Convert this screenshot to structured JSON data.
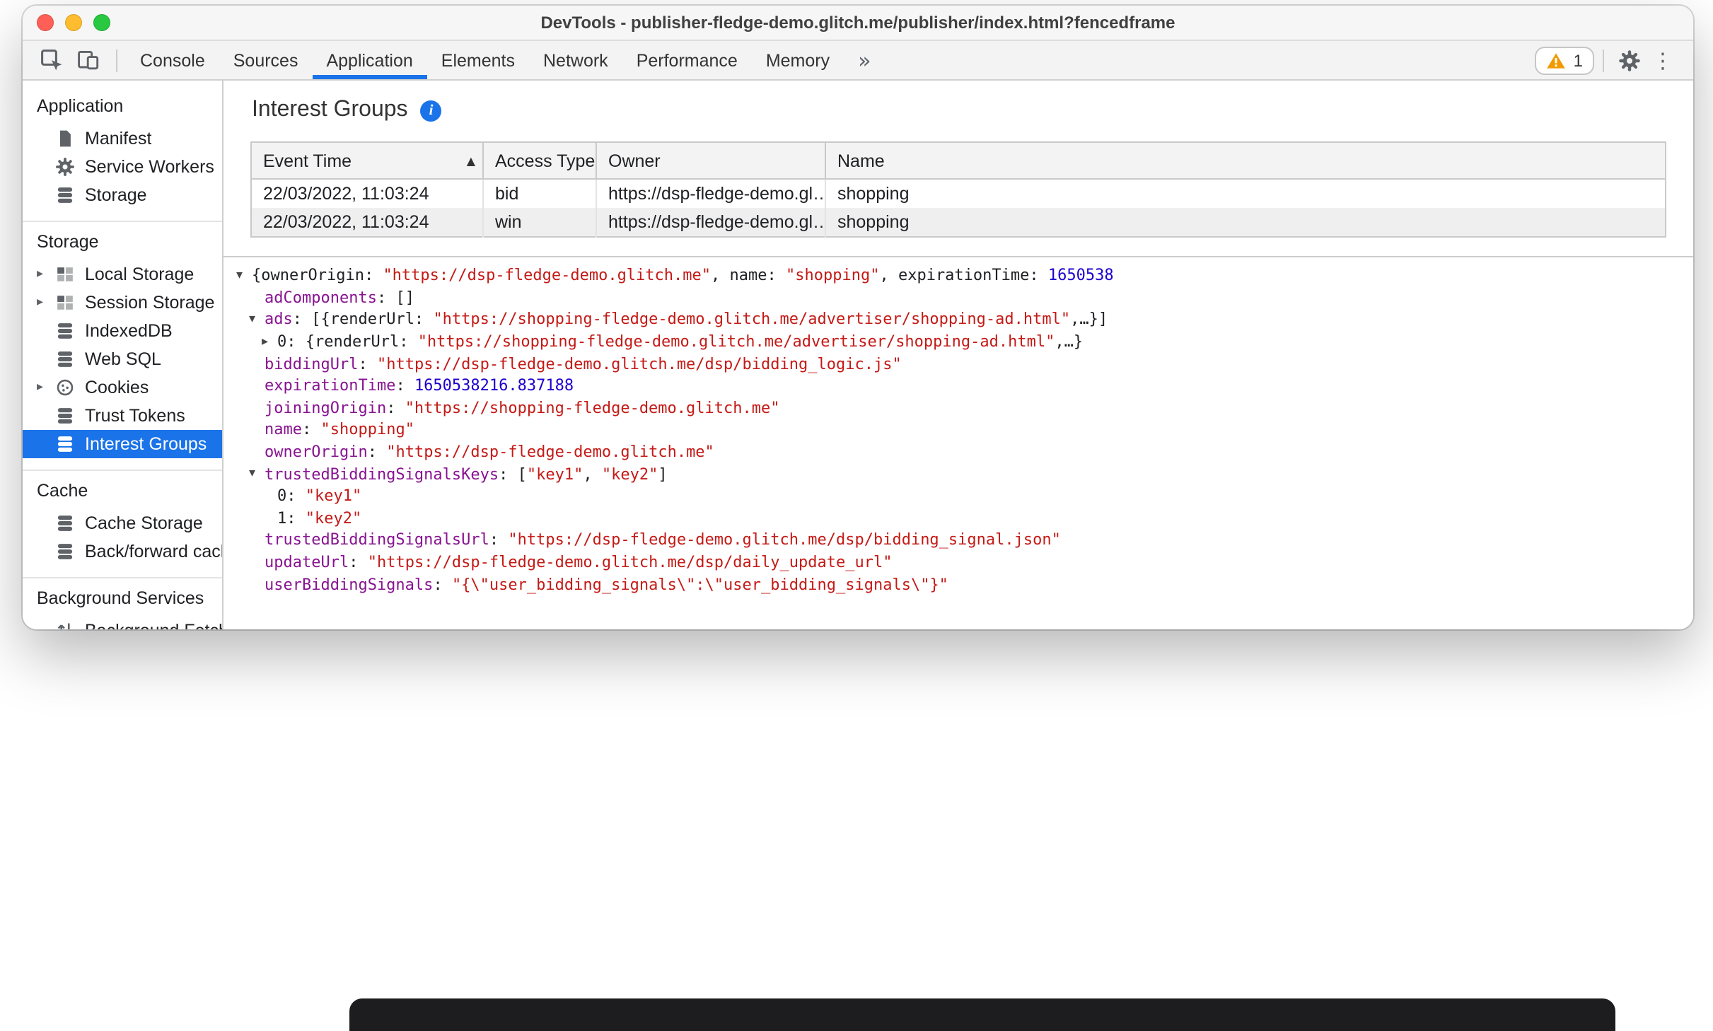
{
  "window": {
    "title": "DevTools - publisher-fledge-demo.glitch.me/publisher/index.html?fencedframe",
    "traffic_lights": {
      "close": "#ff5f57",
      "minimize": "#febc2e",
      "zoom": "#28c840"
    }
  },
  "toolbar": {
    "left_icons": [
      "inspect-icon",
      "device-toolbar-icon"
    ],
    "tabs": [
      {
        "label": "Console",
        "active": false
      },
      {
        "label": "Sources",
        "active": false
      },
      {
        "label": "Application",
        "active": true
      },
      {
        "label": "Elements",
        "active": false
      },
      {
        "label": "Network",
        "active": false
      },
      {
        "label": "Performance",
        "active": false
      },
      {
        "label": "Memory",
        "active": false
      }
    ],
    "warning_badge_count": "1",
    "right_icons": [
      "warning-badge",
      "settings-gear-icon",
      "more-options-icon"
    ]
  },
  "sidebar": {
    "sections": [
      {
        "header": "Application",
        "items": [
          {
            "label": "Manifest",
            "icon": "document-icon"
          },
          {
            "label": "Service Workers",
            "icon": "gear-icon"
          },
          {
            "label": "Storage",
            "icon": "database-icon"
          }
        ]
      },
      {
        "header": "Storage",
        "items": [
          {
            "label": "Local Storage",
            "icon": "table-icon",
            "expandable": true
          },
          {
            "label": "Session Storage",
            "icon": "table-icon",
            "expandable": true
          },
          {
            "label": "IndexedDB",
            "icon": "database-icon"
          },
          {
            "label": "Web SQL",
            "icon": "database-icon"
          },
          {
            "label": "Cookies",
            "icon": "cookie-icon",
            "expandable": true
          },
          {
            "label": "Trust Tokens",
            "icon": "database-icon"
          },
          {
            "label": "Interest Groups",
            "icon": "database-icon",
            "selected": true
          }
        ]
      },
      {
        "header": "Cache",
        "items": [
          {
            "label": "Cache Storage",
            "icon": "database-icon"
          },
          {
            "label": "Back/forward cach",
            "icon": "database-icon"
          }
        ]
      },
      {
        "header": "Background Services",
        "items": [
          {
            "label": "Background Fetch",
            "icon": "fetch-icon"
          }
        ]
      }
    ]
  },
  "main": {
    "title": "Interest Groups",
    "info_icon": "info-icon",
    "table": {
      "columns": [
        "Event Time",
        "Access Type",
        "Owner",
        "Name"
      ],
      "sorted_by": "Event Time",
      "sort_direction": "ascending",
      "rows": [
        [
          "22/03/2022, 11:03:24",
          "bid",
          "https://dsp-fledge-demo.gl…",
          "shopping"
        ],
        [
          "22/03/2022, 11:03:24",
          "win",
          "https://dsp-fledge-demo.gl…",
          "shopping"
        ]
      ]
    },
    "tree": {
      "lines": [
        {
          "level": 0,
          "arrow": "down",
          "segments": [
            {
              "text": "{ownerOrigin: ",
              "cls": "plain"
            },
            {
              "text": "\"https://dsp-fledge-demo.glitch.me\"",
              "cls": "string"
            },
            {
              "text": ", name: ",
              "cls": "plain"
            },
            {
              "text": "\"shopping\"",
              "cls": "string"
            },
            {
              "text": ", expirationTime: ",
              "cls": "plain"
            },
            {
              "text": "1650538",
              "cls": "number"
            }
          ]
        },
        {
          "level": 1,
          "arrow": "none",
          "segments": [
            {
              "text": "adComponents",
              "cls": "key"
            },
            {
              "text": ": []",
              "cls": "plain"
            }
          ]
        },
        {
          "level": 1,
          "arrow": "down",
          "segments": [
            {
              "text": "ads",
              "cls": "key"
            },
            {
              "text": ": [{renderUrl: ",
              "cls": "plain"
            },
            {
              "text": "\"https://shopping-fledge-demo.glitch.me/advertiser/shopping-ad.html\"",
              "cls": "string"
            },
            {
              "text": ",…}]",
              "cls": "plain"
            }
          ]
        },
        {
          "level": 2,
          "arrow": "right",
          "segments": [
            {
              "text": "0",
              "cls": "index"
            },
            {
              "text": ": {renderUrl: ",
              "cls": "plain"
            },
            {
              "text": "\"https://shopping-fledge-demo.glitch.me/advertiser/shopping-ad.html\"",
              "cls": "string"
            },
            {
              "text": ",…}",
              "cls": "plain"
            }
          ]
        },
        {
          "level": 1,
          "arrow": "none",
          "segments": [
            {
              "text": "biddingUrl",
              "cls": "key"
            },
            {
              "text": ": ",
              "cls": "plain"
            },
            {
              "text": "\"https://dsp-fledge-demo.glitch.me/dsp/bidding_logic.js\"",
              "cls": "string"
            }
          ]
        },
        {
          "level": 1,
          "arrow": "none",
          "segments": [
            {
              "text": "expirationTime",
              "cls": "key"
            },
            {
              "text": ": ",
              "cls": "plain"
            },
            {
              "text": "1650538216.837188",
              "cls": "number"
            }
          ]
        },
        {
          "level": 1,
          "arrow": "none",
          "segments": [
            {
              "text": "joiningOrigin",
              "cls": "key"
            },
            {
              "text": ": ",
              "cls": "plain"
            },
            {
              "text": "\"https://shopping-fledge-demo.glitch.me\"",
              "cls": "string"
            }
          ]
        },
        {
          "level": 1,
          "arrow": "none",
          "segments": [
            {
              "text": "name",
              "cls": "key"
            },
            {
              "text": ": ",
              "cls": "plain"
            },
            {
              "text": "\"shopping\"",
              "cls": "string"
            }
          ]
        },
        {
          "level": 1,
          "arrow": "none",
          "segments": [
            {
              "text": "ownerOrigin",
              "cls": "key"
            },
            {
              "text": ": ",
              "cls": "plain"
            },
            {
              "text": "\"https://dsp-fledge-demo.glitch.me\"",
              "cls": "string"
            }
          ]
        },
        {
          "level": 1,
          "arrow": "down",
          "segments": [
            {
              "text": "trustedBiddingSignalsKeys",
              "cls": "key"
            },
            {
              "text": ": [",
              "cls": "plain"
            },
            {
              "text": "\"key1\"",
              "cls": "string"
            },
            {
              "text": ", ",
              "cls": "plain"
            },
            {
              "text": "\"key2\"",
              "cls": "string"
            },
            {
              "text": "]",
              "cls": "plain"
            }
          ]
        },
        {
          "level": 2,
          "arrow": "none",
          "segments": [
            {
              "text": "0",
              "cls": "index"
            },
            {
              "text": ": ",
              "cls": "plain"
            },
            {
              "text": "\"key1\"",
              "cls": "string"
            }
          ]
        },
        {
          "level": 2,
          "arrow": "none",
          "segments": [
            {
              "text": "1",
              "cls": "index"
            },
            {
              "text": ": ",
              "cls": "plain"
            },
            {
              "text": "\"key2\"",
              "cls": "string"
            }
          ]
        },
        {
          "level": 1,
          "arrow": "none",
          "segments": [
            {
              "text": "trustedBiddingSignalsUrl",
              "cls": "key"
            },
            {
              "text": ": ",
              "cls": "plain"
            },
            {
              "text": "\"https://dsp-fledge-demo.glitch.me/dsp/bidding_signal.json\"",
              "cls": "string"
            }
          ]
        },
        {
          "level": 1,
          "arrow": "none",
          "segments": [
            {
              "text": "updateUrl",
              "cls": "key"
            },
            {
              "text": ": ",
              "cls": "plain"
            },
            {
              "text": "\"https://dsp-fledge-demo.glitch.me/dsp/daily_update_url\"",
              "cls": "string"
            }
          ]
        },
        {
          "level": 1,
          "arrow": "none",
          "segments": [
            {
              "text": "userBiddingSignals",
              "cls": "key"
            },
            {
              "text": ": ",
              "cls": "plain"
            },
            {
              "text": "\"{\\\"user_bidding_signals\\\":\\\"user_bidding_signals\\\"}\"",
              "cls": "string"
            }
          ]
        }
      ]
    }
  },
  "glyphs": {
    "expand_arrow": "▸",
    "tree_down": "▾",
    "tree_right": "▸",
    "sort_asc": "▲",
    "more_tabs": "»",
    "more_options": "⋮",
    "info": "i"
  },
  "colors": {
    "accent_blue": "#1a73e8",
    "selected_item_bg": "#1a73e8",
    "json_key": "#881391",
    "json_string": "#c41a16",
    "json_number": "#1c00cf",
    "warning_orange": "#f29900"
  }
}
